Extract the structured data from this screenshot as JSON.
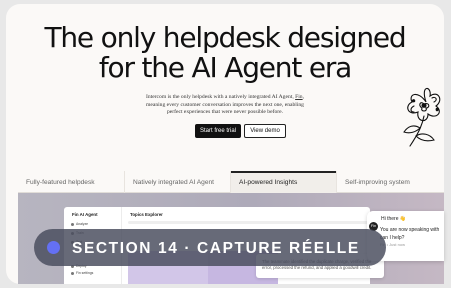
{
  "hero": {
    "title_line1": "The only helpdesk designed",
    "title_line2": "for the AI Agent era",
    "subtitle_line1_pre": "Intercom is the only helpdesk with a natively integrated AI Agent, ",
    "subtitle_fin": "Fin",
    "subtitle_line1_post": ",",
    "subtitle_line2": "meaning every customer conversation improves the next one, enabling",
    "subtitle_line3": "perfect experiences that were never possible before.",
    "primary_cta": "Start free trial",
    "secondary_cta": "View demo"
  },
  "tabs": [
    {
      "label": "Fully-featured helpdesk",
      "active": false
    },
    {
      "label": "Natively integrated AI Agent",
      "active": false
    },
    {
      "label": "AI-powered Insights",
      "active": true
    },
    {
      "label": "Self-improving system",
      "active": false
    }
  ],
  "app_preview": {
    "sidebar_title": "Fin AI Agent",
    "sidebar_items": [
      "Analyze",
      "Train",
      "Test",
      "Deploy",
      "Fin settings"
    ],
    "main_title": "Topics Explorer",
    "popup_line1": "The teammate identified the duplicate charge, verified the",
    "popup_line2": "error, processed the refund, and applied a goodwill credit."
  },
  "chat": {
    "greeting": "Hi there 👋",
    "avatar_label": "Fin",
    "message_line1": "You are now speaking with",
    "message_line2": "can I help?",
    "meta": "Fin • Just now"
  },
  "overlay": {
    "label": "SECTION 14 · CAPTURE RÉELLE"
  },
  "colors": {
    "primary": "#111111",
    "overlay_bg": "#4a4d5e",
    "overlay_dot": "#6470f3",
    "accent_purple": "#d2c6e8"
  }
}
